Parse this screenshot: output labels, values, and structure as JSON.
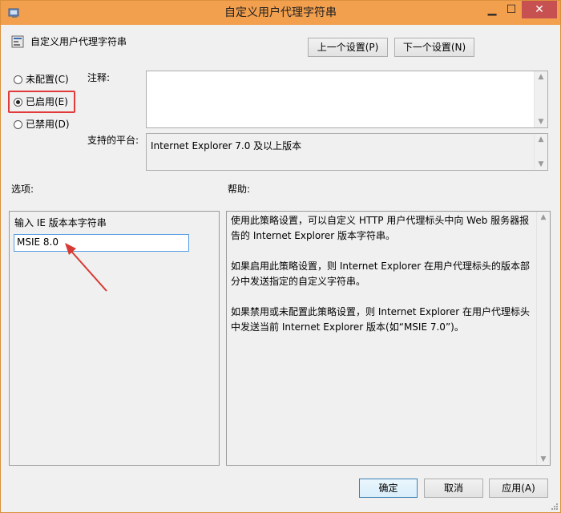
{
  "window": {
    "title": "自定义用户代理字符串"
  },
  "header": {
    "policy_name": "自定义用户代理字符串",
    "prev_button": "上一个设置(P)",
    "next_button": "下一个设置(N)"
  },
  "state": {
    "not_configured": "未配置(C)",
    "enabled": "已启用(E)",
    "disabled": "已禁用(D)",
    "selected": "enabled"
  },
  "comment": {
    "label": "注释:",
    "value": ""
  },
  "platform": {
    "label": "支持的平台:",
    "value": "Internet Explorer 7.0 及以上版本"
  },
  "options": {
    "label": "选项:",
    "field_label": "输入 IE 版本本字符串",
    "field_value": "MSIE 8.0"
  },
  "help": {
    "label": "帮助:",
    "paragraphs": [
      "使用此策略设置，可以自定义 HTTP 用户代理标头中向 Web 服务器报告的 Internet Explorer 版本字符串。",
      "如果启用此策略设置，则 Internet Explorer 在用户代理标头的版本部分中发送指定的自定义字符串。",
      "如果禁用或未配置此策略设置，则 Internet Explorer 在用户代理标头中发送当前 Internet Explorer 版本(如“MSIE 7.0”)。"
    ]
  },
  "footer": {
    "ok": "确定",
    "cancel": "取消",
    "apply": "应用(A)"
  },
  "colors": {
    "titlebar": "#f29f4e",
    "highlight": "#e13a3a",
    "focus_border": "#3c7fb1"
  }
}
